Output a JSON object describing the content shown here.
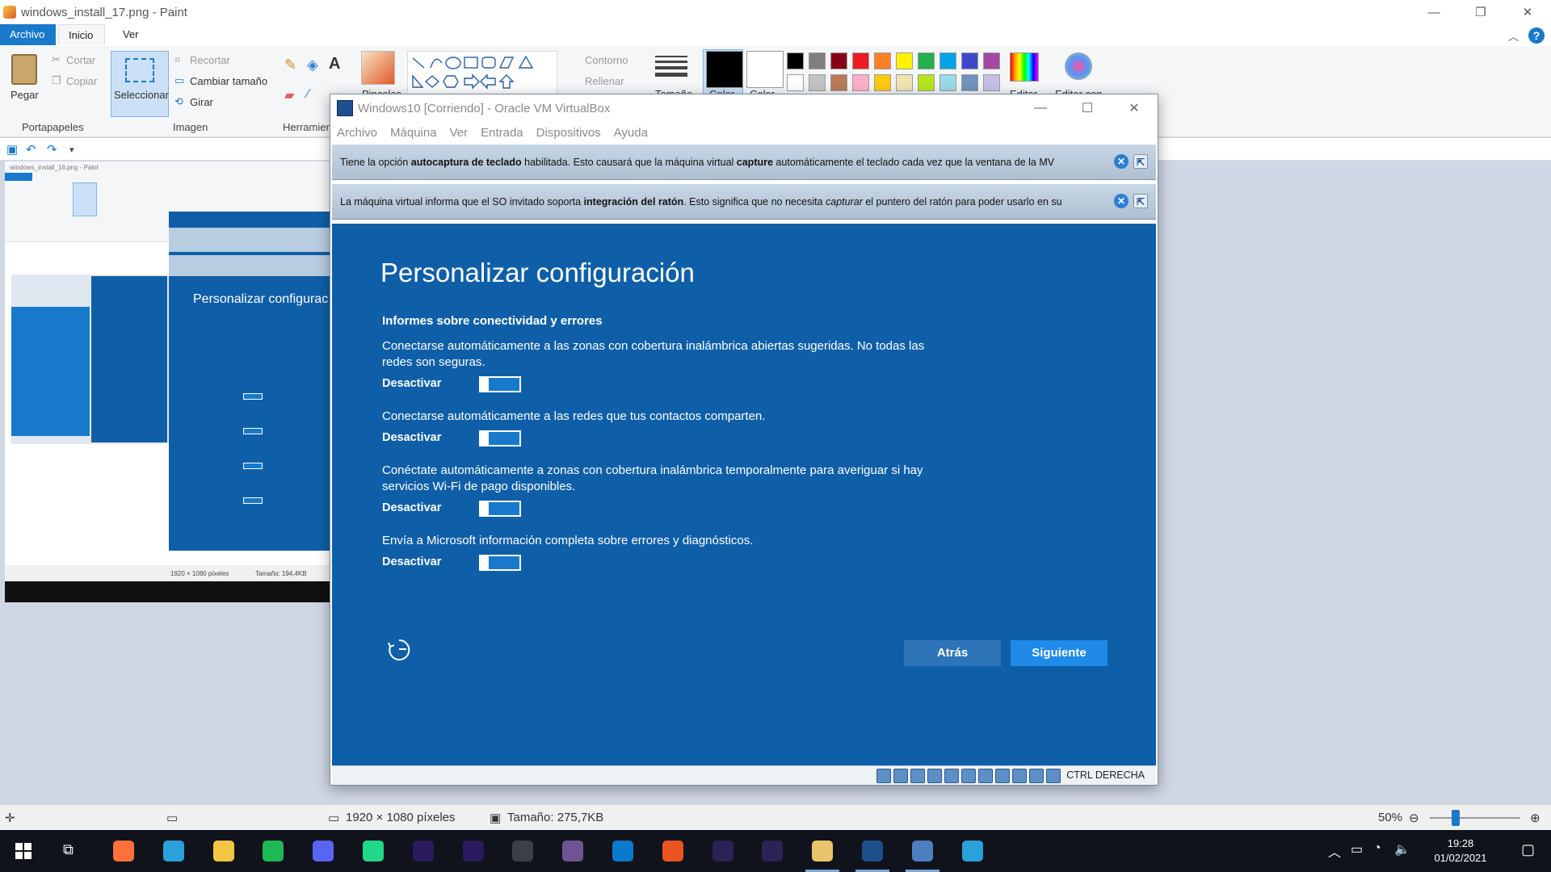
{
  "paint": {
    "title": "windows_install_17.png - Paint",
    "tabs": [
      "Archivo",
      "Inicio",
      "Ver"
    ],
    "ribbon": {
      "clipboard": {
        "paste": "Pegar",
        "cut": "Cortar",
        "copy": "Copiar",
        "label": "Portapapeles"
      },
      "image": {
        "select": "Seleccionar",
        "crop": "Recortar",
        "resize": "Cambiar tamaño",
        "rotate": "Girar",
        "label": "Imagen"
      },
      "tools_label": "Herramien",
      "brushes": "Pinceles",
      "shapes": {
        "outline": "Contorno",
        "fill": "Rellenar"
      },
      "size": "Tamaño",
      "color1": "Color",
      "color2": "Color",
      "edit_colors": "Editar",
      "paint3d": "Editar con"
    },
    "palette_row1": [
      "#000000",
      "#7f7f7f",
      "#880015",
      "#ed1c24",
      "#ff7f27",
      "#fff200",
      "#22b14c",
      "#00a2e8",
      "#3f48cc",
      "#a349a4"
    ],
    "palette_row2": [
      "#ffffff",
      "#c3c3c3",
      "#b97a57",
      "#ffaec9",
      "#ffc90e",
      "#efe4b0",
      "#b5e61d",
      "#99d9ea",
      "#7092be",
      "#c8bfe7"
    ],
    "status": {
      "dimensions": "1920 × 1080 píxeles",
      "size": "Tamaño: 275,7KB",
      "zoom": "50%"
    }
  },
  "vbox": {
    "title": "Windows10 [Corriendo] - Oracle VM VirtualBox",
    "menu": [
      "Archivo",
      "Máquina",
      "Ver",
      "Entrada",
      "Dispositivos",
      "Ayuda"
    ],
    "notice1": {
      "pre": "Tiene la opción ",
      "b1": "autocaptura de teclado",
      "mid": " habilitada. Esto causará que la máquina virtual ",
      "b2": "capture",
      "post": " automáticamente el teclado cada vez que la ventana de la MV"
    },
    "notice2": {
      "pre": "La máquina virtual informa que el SO invitado soporta ",
      "b1": "integración del ratón",
      "mid": ". Esto significa que no necesita ",
      "i1": "capturar",
      "post": " el puntero del ratón para poder usarlo en su"
    },
    "host_key": "CTRL DERECHA"
  },
  "oobe": {
    "title": "Personalizar configuración",
    "section": "Informes sobre conectividad y errores",
    "options": [
      {
        "text": "Conectarse automáticamente a las zonas con cobertura inalámbrica abiertas sugeridas. No todas las redes son seguras.",
        "state": "Desactivar"
      },
      {
        "text": "Conectarse automáticamente a las redes que tus contactos comparten.",
        "state": "Desactivar"
      },
      {
        "text": "Conéctate automáticamente a zonas con cobertura inalámbrica temporalmente para averiguar si hay servicios Wi-Fi de pago disponibles.",
        "state": "Desactivar"
      },
      {
        "text": "Envía a Microsoft información completa sobre errores y diagnósticos.",
        "state": "Desactivar"
      }
    ],
    "back": "Atrás",
    "next": "Siguiente"
  },
  "thumbnail": {
    "title": "windows_install_16.png - Paint",
    "vm_title": "Personalizar configurac",
    "dimensions": "1920 × 1080 píxeles",
    "size": "Tamaño: 194,4KB"
  },
  "taskbar": {
    "time": "19:28",
    "date": "01/02/2021",
    "apps": [
      {
        "name": "firefox-icon",
        "color": "#ff7139"
      },
      {
        "name": "telegram-icon",
        "color": "#2aa1da"
      },
      {
        "name": "file-explorer-icon",
        "color": "#f4c542"
      },
      {
        "name": "spotify-icon",
        "color": "#1db954"
      },
      {
        "name": "discord-icon",
        "color": "#5865f2"
      },
      {
        "name": "pycharm-icon",
        "color": "#21d789"
      },
      {
        "name": "after-effects-icon",
        "color": "#2a1a5e"
      },
      {
        "name": "premiere-icon",
        "color": "#2a1a5e"
      },
      {
        "name": "media-icon",
        "color": "#3a3f4a"
      },
      {
        "name": "github-icon",
        "color": "#6e5494"
      },
      {
        "name": "vscode-icon",
        "color": "#0a7acc"
      },
      {
        "name": "ubuntu-icon",
        "color": "#e95420"
      },
      {
        "name": "eclipse-icon",
        "color": "#2c2255"
      },
      {
        "name": "eclipse-2-icon",
        "color": "#2c2255"
      },
      {
        "name": "paint-icon",
        "color": "#e8c56a"
      },
      {
        "name": "virtualbox-icon",
        "color": "#1c4f8c"
      },
      {
        "name": "windows10-vm-icon",
        "color": "#4c7fbf"
      },
      {
        "name": "telegram-2-icon",
        "color": "#2aa1da"
      }
    ]
  }
}
